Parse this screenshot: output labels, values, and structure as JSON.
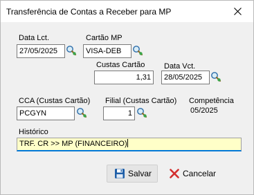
{
  "window": {
    "title": "Transferência de Contas a Receber para MP"
  },
  "form": {
    "data_lct": {
      "label": "Data Lct.",
      "value": "27/05/2025"
    },
    "cartao_mp": {
      "label": "Cartão MP",
      "value": "VISA-DEB"
    },
    "custas_cartao": {
      "label": "Custas Cartão",
      "value": "1,31"
    },
    "data_vct": {
      "label": "Data Vct.",
      "value": "28/05/2025"
    },
    "cca": {
      "label": "CCA (Custas Cartão)",
      "value": "PCGYN"
    },
    "filial": {
      "label": "Filial (Custas Cartão)",
      "value": "1"
    },
    "competencia": {
      "label": "Competência",
      "value": "05/2025"
    },
    "historico": {
      "label": "Histórico",
      "value": "TRF. CR >> MP (FINANCEIRO)"
    }
  },
  "buttons": {
    "save": "Salvar",
    "cancel": "Cancelar"
  },
  "icons": {
    "lookup": "search-lookup-icon",
    "save": "floppy-disk-icon",
    "cancel": "red-x-icon",
    "close": "close-icon"
  },
  "colors": {
    "history_bg": "#ffffc8",
    "focus_border": "#0078d7",
    "cancel_red": "#d32f2f",
    "save_blue": "#1f5fa8"
  }
}
